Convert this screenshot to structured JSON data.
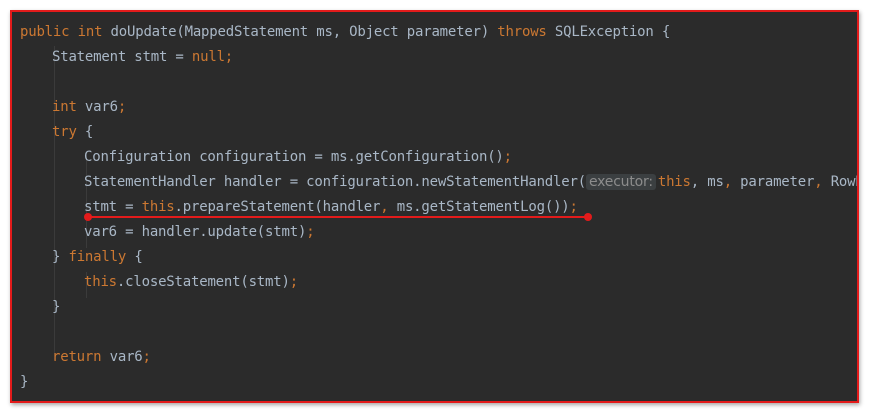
{
  "editor": {
    "lines": [
      {
        "tokens": [
          {
            "t": "public ",
            "c": "kw"
          },
          {
            "t": "int ",
            "c": "kw"
          },
          {
            "t": "doUpdate(MappedStatement ms, Object parameter) ",
            "c": "pl"
          },
          {
            "t": "throws ",
            "c": "kw"
          },
          {
            "t": "SQLException {",
            "c": "pl"
          }
        ]
      },
      {
        "tokens": [
          {
            "t": "Statement stmt = ",
            "c": "pl"
          },
          {
            "t": "null;",
            "c": "kw"
          }
        ]
      },
      {
        "tokens": []
      },
      {
        "tokens": [
          {
            "t": "int ",
            "c": "kw"
          },
          {
            "t": "var6",
            "c": "pl"
          },
          {
            "t": ";",
            "c": "kw"
          }
        ]
      },
      {
        "tokens": [
          {
            "t": "try ",
            "c": "kw"
          },
          {
            "t": "{",
            "c": "pl"
          }
        ]
      },
      {
        "tokens": [
          {
            "t": "Configuration configuration = ms.getConfiguration()",
            "c": "pl"
          },
          {
            "t": ";",
            "c": "kw"
          }
        ]
      },
      {
        "tokens": [
          {
            "t": "StatementHandler handler = configuration.newStatementHandler(",
            "c": "pl"
          },
          {
            "t": "executor:",
            "c": "hint"
          },
          {
            "t": "this",
            "c": "kw"
          },
          {
            "t": ", ms",
            "c": "pl"
          },
          {
            "t": ", ",
            "c": "kw"
          },
          {
            "t": "parameter",
            "c": "pl"
          },
          {
            "t": ", ",
            "c": "kw"
          },
          {
            "t": "RowBounds.DEFAULT",
            "c": "pl"
          }
        ]
      },
      {
        "tokens": [
          {
            "t": "stmt = ",
            "c": "pl"
          },
          {
            "t": "this",
            "c": "kw"
          },
          {
            "t": ".prepareStatement(handler",
            "c": "pl"
          },
          {
            "t": ", ",
            "c": "kw"
          },
          {
            "t": "ms.getStatementLog())",
            "c": "pl"
          },
          {
            "t": ";",
            "c": "kw"
          }
        ]
      },
      {
        "tokens": [
          {
            "t": "var6 = handler.update(stmt)",
            "c": "pl"
          },
          {
            "t": ";",
            "c": "kw"
          }
        ]
      },
      {
        "tokens": [
          {
            "t": "} ",
            "c": "pl"
          },
          {
            "t": "finally ",
            "c": "kw"
          },
          {
            "t": "{",
            "c": "pl"
          }
        ]
      },
      {
        "tokens": [
          {
            "t": "this",
            "c": "kw"
          },
          {
            "t": ".closeStatement(stmt)",
            "c": "pl"
          },
          {
            "t": ";",
            "c": "kw"
          }
        ]
      },
      {
        "tokens": [
          {
            "t": "}",
            "c": "pl"
          }
        ]
      },
      {
        "tokens": []
      },
      {
        "tokens": [
          {
            "t": "return ",
            "c": "kw"
          },
          {
            "t": "var6",
            "c": "pl"
          },
          {
            "t": ";",
            "c": "kw"
          }
        ]
      },
      {
        "tokens": [
          {
            "t": "}",
            "c": "pl"
          }
        ]
      }
    ]
  },
  "colors": {
    "background": "#2b2b2b",
    "keyword": "#cc7832",
    "plain": "#a9b7c6",
    "hint_bg": "#3b3f41",
    "hint_fg": "#8c8c8c",
    "annotation": "#e31b1b"
  }
}
